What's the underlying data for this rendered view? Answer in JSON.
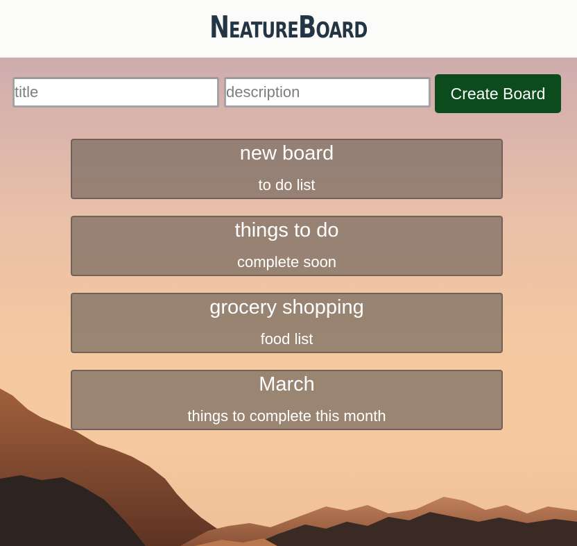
{
  "app": {
    "logo_text": "NeatureBoard"
  },
  "form": {
    "title_placeholder": "title",
    "description_placeholder": "description",
    "create_label": "Create Board"
  },
  "boards": [
    {
      "title": "new board",
      "description": "to do list"
    },
    {
      "title": "things to do",
      "description": "complete soon"
    },
    {
      "title": "grocery shopping",
      "description": "food list"
    },
    {
      "title": "March",
      "description": "things to complete this month"
    }
  ],
  "colors": {
    "header_bg": "#fbfbf9",
    "logo": "#233444",
    "create_button": "#0c4b1b",
    "card_bg": "rgba(125,110,100,0.76)"
  }
}
